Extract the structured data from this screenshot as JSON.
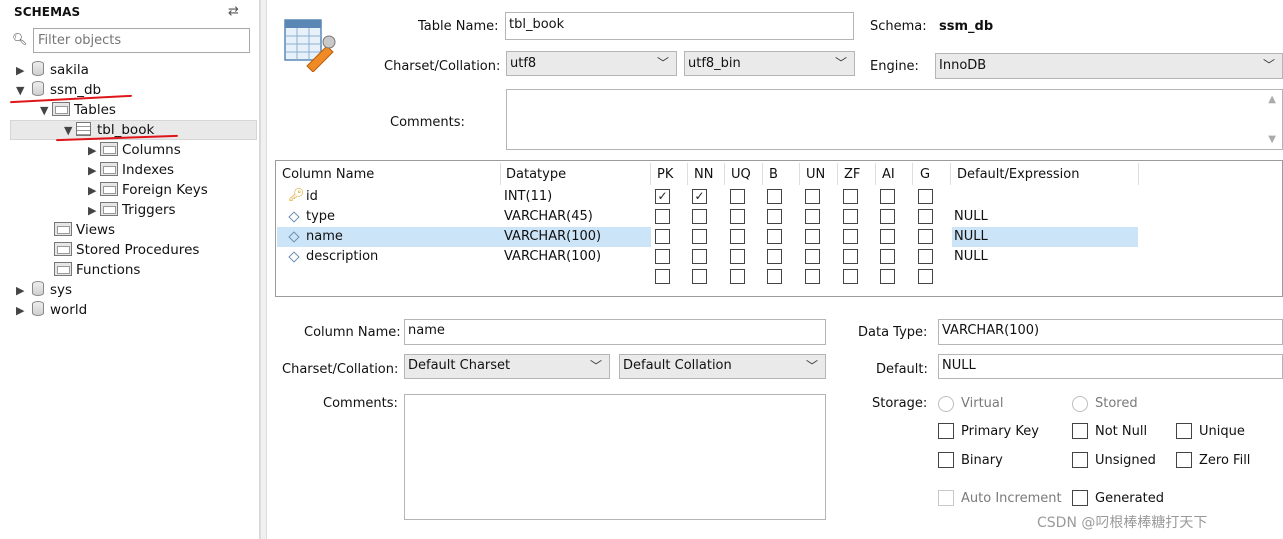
{
  "sidebar": {
    "title": "SCHEMAS",
    "refresh_icon": "refresh-arrows-icon",
    "filter_placeholder": "Filter objects",
    "tree": {
      "sakila": "sakila",
      "ssm_db": "ssm_db",
      "tables": "Tables",
      "tbl_book": "tbl_book",
      "columns": "Columns",
      "indexes": "Indexes",
      "foreign_keys": "Foreign Keys",
      "triggers": "Triggers",
      "views": "Views",
      "stored_procedures": "Stored Procedures",
      "functions": "Functions",
      "sys": "sys",
      "world": "world"
    }
  },
  "table_form": {
    "table_name_label": "Table Name:",
    "table_name_value": "tbl_book",
    "schema_label": "Schema:",
    "schema_value": "ssm_db",
    "charset_label": "Charset/Collation:",
    "charset_value": "utf8",
    "collation_value": "utf8_bin",
    "engine_label": "Engine:",
    "engine_value": "InnoDB",
    "comments_label": "Comments:"
  },
  "grid": {
    "headers": {
      "column_name": "Column Name",
      "datatype": "Datatype",
      "pk": "PK",
      "nn": "NN",
      "uq": "UQ",
      "b": "B",
      "un": "UN",
      "zf": "ZF",
      "ai": "AI",
      "g": "G",
      "default": "Default/Expression"
    },
    "rows": [
      {
        "name": "id",
        "type": "INT(11)",
        "default": "",
        "pk": true,
        "nn": true
      },
      {
        "name": "type",
        "type": "VARCHAR(45)",
        "default": "NULL",
        "pk": false,
        "nn": false
      },
      {
        "name": "name",
        "type": "VARCHAR(100)",
        "default": "NULL",
        "pk": false,
        "nn": false
      },
      {
        "name": "description",
        "type": "VARCHAR(100)",
        "default": "NULL",
        "pk": false,
        "nn": false
      }
    ],
    "check_mark": "✓"
  },
  "column_detail": {
    "column_name_label": "Column Name:",
    "column_name_value": "name",
    "charset_label": "Charset/Collation:",
    "charset_value": "Default Charset",
    "collation_value": "Default Collation",
    "comments_label": "Comments:",
    "data_type_label": "Data Type:",
    "data_type_value": "VARCHAR(100)",
    "default_label": "Default:",
    "default_value": "NULL",
    "storage_label": "Storage:",
    "virtual": "Virtual",
    "stored": "Stored",
    "primary_key": "Primary Key",
    "not_null": "Not Null",
    "unique": "Unique",
    "binary": "Binary",
    "unsigned": "Unsigned",
    "zero_fill": "Zero Fill",
    "auto_increment": "Auto Increment",
    "generated": "Generated"
  },
  "watermark": "CSDN @叼根棒棒糖打天下",
  "colors": {
    "selection_blue": "#cce4f7",
    "annotation_red": "#e0151a",
    "tree_selected": "#e9e9e9"
  }
}
